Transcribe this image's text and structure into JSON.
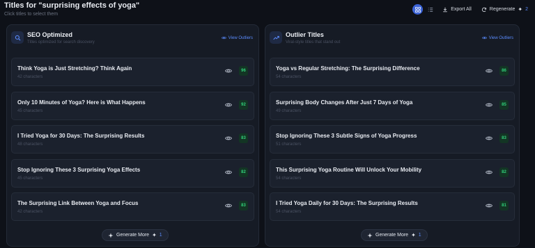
{
  "header": {
    "title": "Titles for \"surprising effects of yoga\"",
    "subtitle": "Click titles to select them",
    "export_label": "Export All",
    "regenerate_label": "Regenerate",
    "regenerate_count": "2",
    "spark": "✦",
    "accent_color": "#3b63d6"
  },
  "panels": [
    {
      "title": "SEO Optimized",
      "subtitle": "Titles optimized for search discovery",
      "link_label": "View Outliers",
      "generate_label": "Generate More",
      "generate_count": "1",
      "cards": [
        {
          "title": "Think Yoga is Just Stretching? Think Again",
          "meta": "42 characters",
          "score": "96"
        },
        {
          "title": "Only 10 Minutes of Yoga? Here is What Happens",
          "meta": "45 characters",
          "score": "92"
        },
        {
          "title": "I Tried Yoga for 30 Days: The Surprising Results",
          "meta": "48 characters",
          "score": "83"
        },
        {
          "title": "Stop Ignoring These 3 Surprising Yoga Effects",
          "meta": "45 characters",
          "score": "82"
        },
        {
          "title": "The Surprising Link Between Yoga and Focus",
          "meta": "42 characters",
          "score": "83"
        }
      ]
    },
    {
      "title": "Outlier Titles",
      "subtitle": "Viral-style titles that stand out",
      "link_label": "View Outliers",
      "generate_label": "Generate More",
      "generate_count": "1",
      "cards": [
        {
          "title": "Yoga vs Regular Stretching: The Surprising Difference",
          "meta": "54 characters",
          "score": "86"
        },
        {
          "title": "Surprising Body Changes After Just 7 Days of Yoga",
          "meta": "49 characters",
          "score": "85"
        },
        {
          "title": "Stop Ignoring These 3 Subtle Signs of Yoga Progress",
          "meta": "51 characters",
          "score": "83"
        },
        {
          "title": "This Surprising Yoga Routine Will Unlock Your Mobility",
          "meta": "54 characters",
          "score": "82"
        },
        {
          "title": "I Tried Yoga Daily for 30 Days: The Surprising Results",
          "meta": "54 characters",
          "score": "81"
        }
      ]
    }
  ]
}
